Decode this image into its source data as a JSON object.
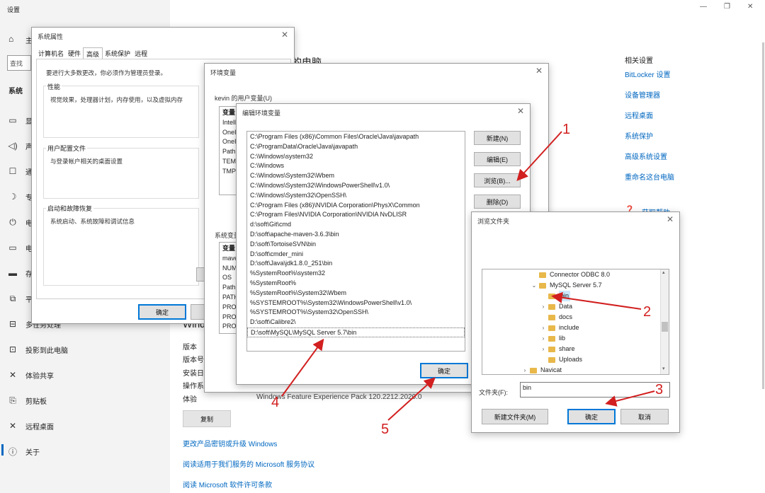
{
  "settings": {
    "title": "设置",
    "home_label": "主",
    "search_placeholder": "查找",
    "section": "系统",
    "nav": [
      {
        "icon": "display-icon",
        "glyph": "▭",
        "label": "显"
      },
      {
        "icon": "sound-icon",
        "glyph": "◁)",
        "label": "声"
      },
      {
        "icon": "notifications-icon",
        "glyph": "☐",
        "label": "通"
      },
      {
        "icon": "focus-icon",
        "glyph": "☽",
        "label": "专"
      },
      {
        "icon": "power-icon",
        "glyph": "⏻",
        "label": "电"
      },
      {
        "icon": "battery-icon",
        "glyph": "▭",
        "label": "电"
      },
      {
        "icon": "storage-icon",
        "glyph": "▬",
        "label": "存"
      },
      {
        "icon": "tablet-icon",
        "glyph": "⧉",
        "label": "平"
      },
      {
        "icon": "multitask-icon",
        "glyph": "⊟",
        "label": "多任务处理"
      },
      {
        "icon": "project-icon",
        "glyph": "⊡",
        "label": "投影到此电脑"
      },
      {
        "icon": "shared-experience-icon",
        "glyph": "✕",
        "label": "体验共享"
      },
      {
        "icon": "clipboard-icon",
        "glyph": "⎘",
        "label": "剪贴板"
      },
      {
        "icon": "remote-desktop-icon",
        "glyph": "✕",
        "label": "远程桌面"
      },
      {
        "icon": "about-icon",
        "glyph": "ⓘ",
        "label": "关于"
      }
    ],
    "window_controls": {
      "minimize": "—",
      "maximize": "❐",
      "close": "✕"
    },
    "main_heading_partial": "的电脑",
    "related_title": "相关设置",
    "related_links": [
      "BitLocker 设置",
      "设备管理器",
      "远程桌面",
      "系统保护",
      "高级系统设置",
      "重命名这台电脑"
    ],
    "help_link": "获取帮助",
    "windows_spec_partial": "Windo",
    "spec_labels": [
      "版本",
      "版本号",
      "安装日",
      "操作系",
      "体验"
    ],
    "experience_value": "Windows Feature Experience Pack 120.2212.2020.0",
    "copy_button": "复制",
    "bottom_links": [
      "更改产品密钥或升级 Windows",
      "阅读适用于我们服务的 Microsoft 服务协议",
      "阅读 Microsoft 软件许可条款"
    ]
  },
  "sysprops": {
    "title": "系统属性",
    "tabs": [
      "计算机名",
      "硬件",
      "高级",
      "系统保护",
      "远程"
    ],
    "admin_note": "要进行大多数更改，你必须作为管理员登录。",
    "perf_label": "性能",
    "perf_desc": "视觉效果，处理器计划，内存使用，以及虚拟内存",
    "profile_label": "用户配置文件",
    "profile_desc": "与登录帐户相关的桌面设置",
    "startup_label": "启动和故障恢复",
    "startup_desc": "系统启动、系统故障和调试信息",
    "ok": "确定"
  },
  "envvars": {
    "title": "环境变量",
    "user_vars_label": "kevin 的用户变量(U)",
    "user_col": "变量",
    "user_rows": [
      "Intell",
      "OneI",
      "OneI",
      "Path",
      "TEMI",
      "TMP"
    ],
    "sys_vars_label": "系统变量",
    "sys_col": "变量",
    "sys_rows": [
      "mave",
      "NUM",
      "OS",
      "Path",
      "PATH",
      "PROC",
      "PROC",
      "PROC"
    ]
  },
  "editenv": {
    "title": "编辑环境变量",
    "paths": [
      "C:\\Program Files (x86)\\Common Files\\Oracle\\Java\\javapath",
      "C:\\ProgramData\\Oracle\\Java\\javapath",
      "C:\\Windows\\system32",
      "C:\\Windows",
      "C:\\Windows\\System32\\Wbem",
      "C:\\Windows\\System32\\WindowsPowerShell\\v1.0\\",
      "C:\\Windows\\System32\\OpenSSH\\",
      "C:\\Program Files (x86)\\NVIDIA Corporation\\PhysX\\Common",
      "C:\\Program Files\\NVIDIA Corporation\\NVIDIA NvDLISR",
      "d:\\soft\\Git\\cmd",
      "D:\\soft\\apache-maven-3.6.3\\bin",
      "D:\\soft\\TortoiseSVN\\bin",
      "D:\\soft\\cmder_mini",
      "D:\\soft\\Java\\jdk1.8.0_251\\bin",
      "%SystemRoot%\\system32",
      "%SystemRoot%",
      "%SystemRoot%\\System32\\Wbem",
      "%SYSTEMROOT%\\System32\\WindowsPowerShell\\v1.0\\",
      "%SYSTEMROOT%\\System32\\OpenSSH\\",
      "D:\\soft\\Calibre2\\",
      "D:\\soft\\MySQL\\MySQL Server 5.7\\bin"
    ],
    "new": "新建(N)",
    "edit": "编辑(E)",
    "browse": "浏览(B)...",
    "delete": "删除(D)",
    "ok": "确定"
  },
  "browse": {
    "title": "浏览文件夹",
    "tree": [
      {
        "label": "Connector ODBC 8.0",
        "chev": "",
        "indent": 0
      },
      {
        "label": "MySQL Server 5.7",
        "chev": "⌄",
        "indent": 0
      },
      {
        "label": "bin",
        "chev": "",
        "indent": 1
      },
      {
        "label": "Data",
        "chev": "›",
        "indent": 1
      },
      {
        "label": "docs",
        "chev": "",
        "indent": 1
      },
      {
        "label": "include",
        "chev": "›",
        "indent": 1
      },
      {
        "label": "lib",
        "chev": "›",
        "indent": 1
      },
      {
        "label": "share",
        "chev": "›",
        "indent": 1
      },
      {
        "label": "Uploads",
        "chev": "",
        "indent": 1
      },
      {
        "label": "Navicat",
        "chev": "›",
        "indent": -1
      }
    ],
    "folder_label": "文件夹(F):",
    "folder_value": "bin",
    "new_folder": "新建文件夹(M)",
    "ok": "确定",
    "cancel": "取消"
  },
  "annotations": [
    "1",
    "2",
    "3",
    "4",
    "5"
  ],
  "colors": {
    "accent": "#0067c0",
    "annotation": "#d21f1f",
    "folder": "#e8b84a"
  }
}
